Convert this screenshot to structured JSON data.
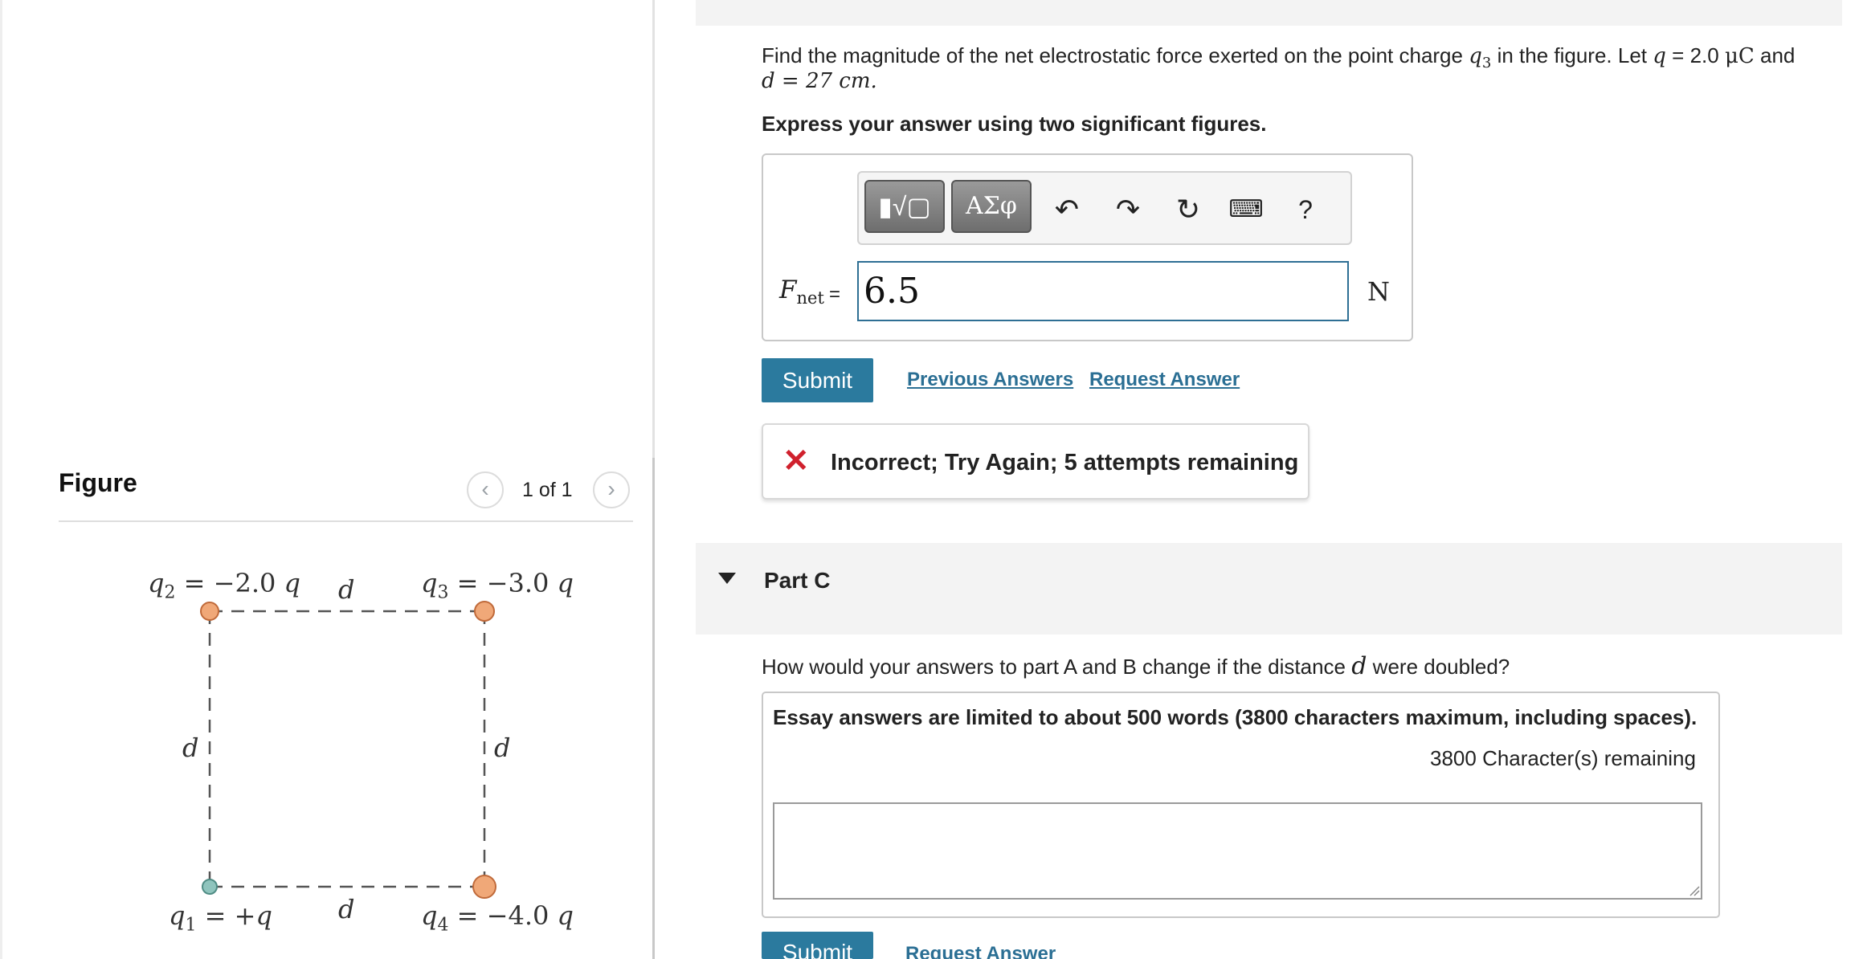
{
  "figure": {
    "title": "Figure",
    "prev_icon": "chevron-left-icon",
    "next_icon": "chevron-right-icon",
    "counter": "1 of 1",
    "labels": {
      "q2_sym": "q",
      "q2_sub": "2",
      "q2_val": "= −2.0",
      "q3_sym": "q",
      "q3_sub": "3",
      "q3_val": "= −3.0",
      "q1_sym": "q",
      "q1_sub": "1",
      "q1_val": "= +",
      "q4_sym": "q",
      "q4_sub": "4",
      "q4_val": "= −4.0",
      "q_unit": "q",
      "d": "d"
    },
    "colors": {
      "negative_charge": "#f0a878",
      "positive_charge": "#8fc4bd",
      "square": "#555555"
    }
  },
  "question": {
    "line1_pre": "Find the magnitude of the net electrostatic force exerted on the point charge",
    "line1_charge": "q",
    "line1_charge_sub": "3",
    "line1_mid": "in the figure. Let",
    "line1_q": "q",
    "line1_val": "= 2.0",
    "line1_unit": "μC",
    "line1_end": "and",
    "line2": "d = 27 cm.",
    "instruction": "Express your answer using two significant figures."
  },
  "toolbar": {
    "template_icon": "template-sqrt-icon",
    "greek_label": "ΑΣφ",
    "undo_icon": "undo-icon",
    "redo_icon": "redo-icon",
    "reset_icon": "reset-icon",
    "keyboard_icon": "keyboard-icon",
    "help_label": "?"
  },
  "answer": {
    "label_main": "F",
    "label_sub": "net",
    "equals": "=",
    "value": "6.5",
    "unit": "N"
  },
  "actions": {
    "submit_label": "Submit",
    "previous_answers": "Previous Answers",
    "request_answer": "Request Answer"
  },
  "feedback": {
    "message": "Incorrect; Try Again; 5 attempts remaining",
    "color": "#d0212d"
  },
  "part_c": {
    "label": "Part C",
    "question_pre": "How would your answers to part A and B change if the distance",
    "question_var": "d",
    "question_post": "were doubled?",
    "essay_note": "Essay answers are limited to about 500 words (3800 characters maximum, including spaces).",
    "remaining": "3800 Character(s) remaining",
    "essay_value": "",
    "submit_label": "Submit",
    "request_answer": "Request Answer"
  }
}
